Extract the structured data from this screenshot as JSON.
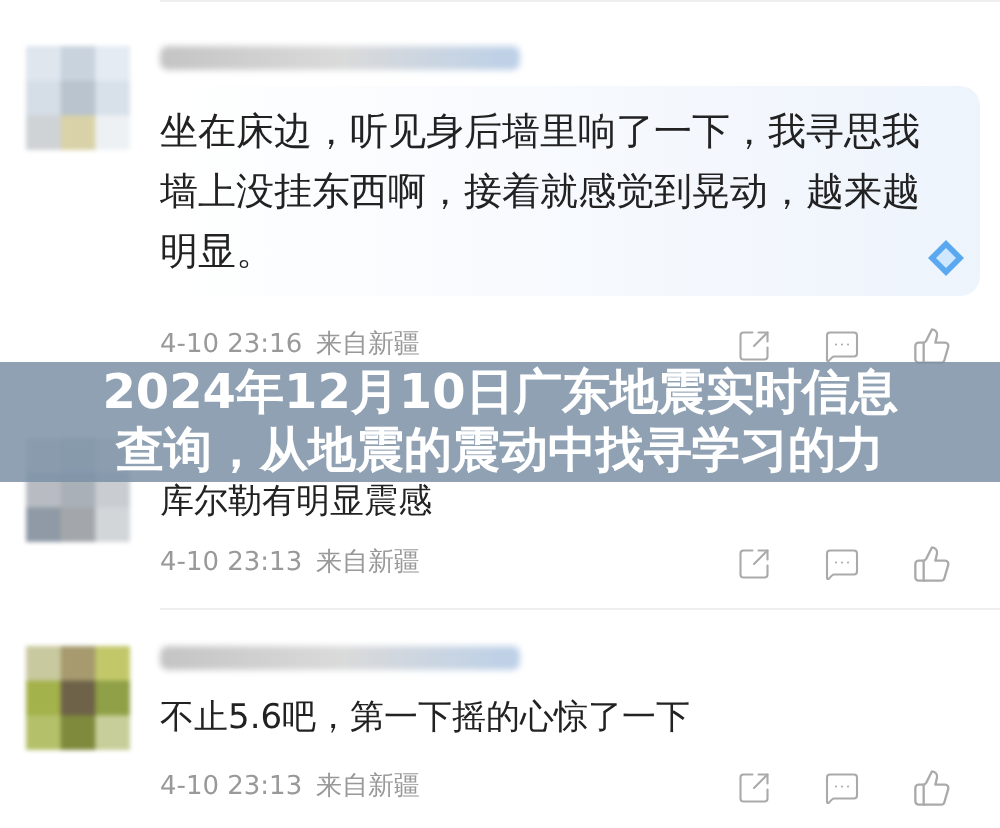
{
  "comments": [
    {
      "text": "坐在床边，听见身后墙里响了一下，我寻思我墙上没挂东西啊，接着就感觉到晃动，越来越明显。",
      "time": "4-10 23:16",
      "location": "来自新疆",
      "bubble": true
    },
    {
      "text": "库尔勒有明显震感",
      "time": "4-10 23:13",
      "location": "来自新疆",
      "bubble": false
    },
    {
      "text": "不止5.6吧，第一下摇的心惊了一下",
      "time": "4-10 23:13",
      "location": "来自新疆",
      "bubble": false
    }
  ],
  "banner": {
    "title_lines": [
      "2024年12月10日广东地震实时信息",
      "查询，从地震的震动中找寻学习的力"
    ]
  }
}
